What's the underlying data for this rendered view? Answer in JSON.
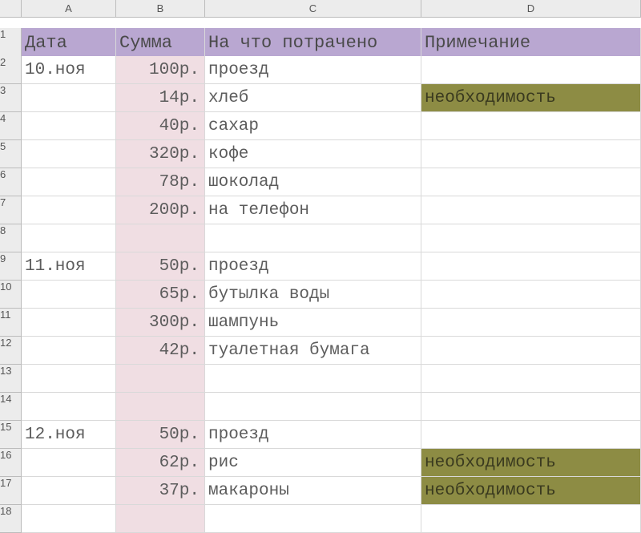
{
  "columns": [
    "A",
    "B",
    "C",
    "D"
  ],
  "headers": {
    "A": "Дата",
    "B": "Сумма",
    "C": "На что потрачено",
    "D": "Примечание"
  },
  "rows": [
    {
      "n": "2",
      "A": "10.ноя",
      "B": "100р.",
      "C": "проезд",
      "D": ""
    },
    {
      "n": "3",
      "A": "",
      "B": "14р.",
      "C": "хлеб",
      "D": "необходимость",
      "noteHighlight": true
    },
    {
      "n": "4",
      "A": "",
      "B": "40р.",
      "C": "сахар",
      "D": ""
    },
    {
      "n": "5",
      "A": "",
      "B": "320р.",
      "C": "кофе",
      "D": ""
    },
    {
      "n": "6",
      "A": "",
      "B": "78р.",
      "C": "шоколад",
      "D": ""
    },
    {
      "n": "7",
      "A": "",
      "B": "200р.",
      "C": "на телефон",
      "D": ""
    },
    {
      "n": "8",
      "A": "",
      "B": "",
      "C": "",
      "D": ""
    },
    {
      "n": "9",
      "A": "11.ноя",
      "B": "50р.",
      "C": "проезд",
      "D": ""
    },
    {
      "n": "10",
      "A": "",
      "B": "65р.",
      "C": "бутылка воды",
      "D": ""
    },
    {
      "n": "11",
      "A": "",
      "B": "300р.",
      "C": "шампунь",
      "D": ""
    },
    {
      "n": "12",
      "A": "",
      "B": "42р.",
      "C": "туалетная бумага",
      "D": ""
    },
    {
      "n": "13",
      "A": "",
      "B": "",
      "C": "",
      "D": ""
    },
    {
      "n": "14",
      "A": "",
      "B": "",
      "C": "",
      "D": ""
    },
    {
      "n": "15",
      "A": "12.ноя",
      "B": "50р.",
      "C": "проезд",
      "D": ""
    },
    {
      "n": "16",
      "A": "",
      "B": "62р.",
      "C": "рис",
      "D": "необходимость",
      "noteHighlight": true
    },
    {
      "n": "17",
      "A": "",
      "B": "37р.",
      "C": "макароны",
      "D": "необходимость",
      "noteHighlight": true
    },
    {
      "n": "18",
      "A": "",
      "B": "",
      "C": "",
      "D": ""
    }
  ]
}
